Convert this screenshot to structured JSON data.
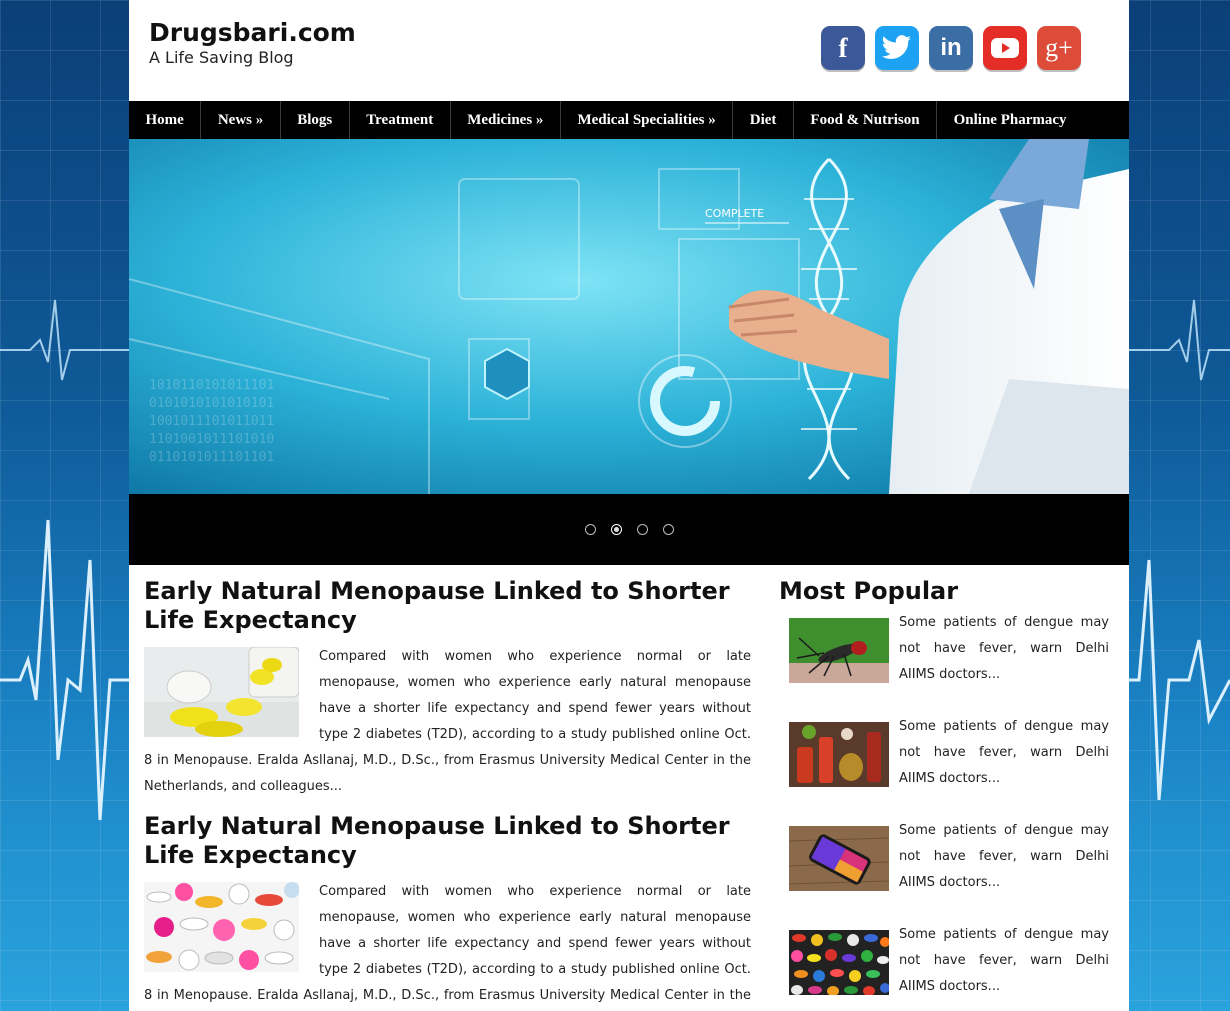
{
  "header": {
    "site_title": "Drugsbari.com",
    "tagline": "A Life Saving Blog",
    "social": [
      {
        "name": "facebook-icon",
        "glyph": "f",
        "color": "#3b5998"
      },
      {
        "name": "twitter-icon",
        "glyph": "t",
        "color": "#1da1f2"
      },
      {
        "name": "linkedin-icon",
        "glyph": "in",
        "color": "#3a6ea5"
      },
      {
        "name": "youtube-icon",
        "glyph": "▶",
        "color": "#e52d27"
      },
      {
        "name": "google-plus-icon",
        "glyph": "g+",
        "color": "#dd4b39"
      }
    ]
  },
  "nav": {
    "items": [
      "Home",
      "News »",
      "Blogs",
      "Treatment",
      "Medicines »",
      "Medical Specialities »",
      "Diet",
      "Food & Nutrison",
      "Online Pharmacy"
    ]
  },
  "slider": {
    "overlay_text": "COMPLETE",
    "dots": 4,
    "active_dot": 2
  },
  "posts": [
    {
      "title": "Early Natural Menopause Linked to Shorter Life Expectancy",
      "excerpt": "Compared with women who experience normal or late menopause, women who experience early natural menopause have a shorter life expectancy and spend fewer years without type 2 diabetes (T2D), according to a study published online Oct. 8 in Menopause. Eralda Asllanaj, M.D., D.Sc., from Erasmus University Medical Center in the Netherlands, and colleagues..."
    },
    {
      "title": "Early Natural Menopause Linked to Shorter Life Expectancy",
      "excerpt": "Compared with women who experience normal or late menopause, women who experience early natural menopause have a shorter life expectancy and spend fewer years without type 2 diabetes (T2D), according to a study published online Oct. 8 in Menopause. Eralda Asllanaj, M.D., D.Sc., from Erasmus University Medical Center in the Netherlands, and"
    }
  ],
  "sidebar": {
    "title": "Most Popular",
    "items": [
      {
        "text": "Some patients of dengue may not have fever, warn Delhi AIIMS doctors..."
      },
      {
        "text": "Some patients of dengue may not have fever, warn Delhi AIIMS doctors..."
      },
      {
        "text": "Some patients of dengue may not have fever, warn Delhi AIIMS doctors..."
      },
      {
        "text": "Some patients of dengue may not have fever, warn Delhi AIIMS doctors..."
      }
    ]
  }
}
